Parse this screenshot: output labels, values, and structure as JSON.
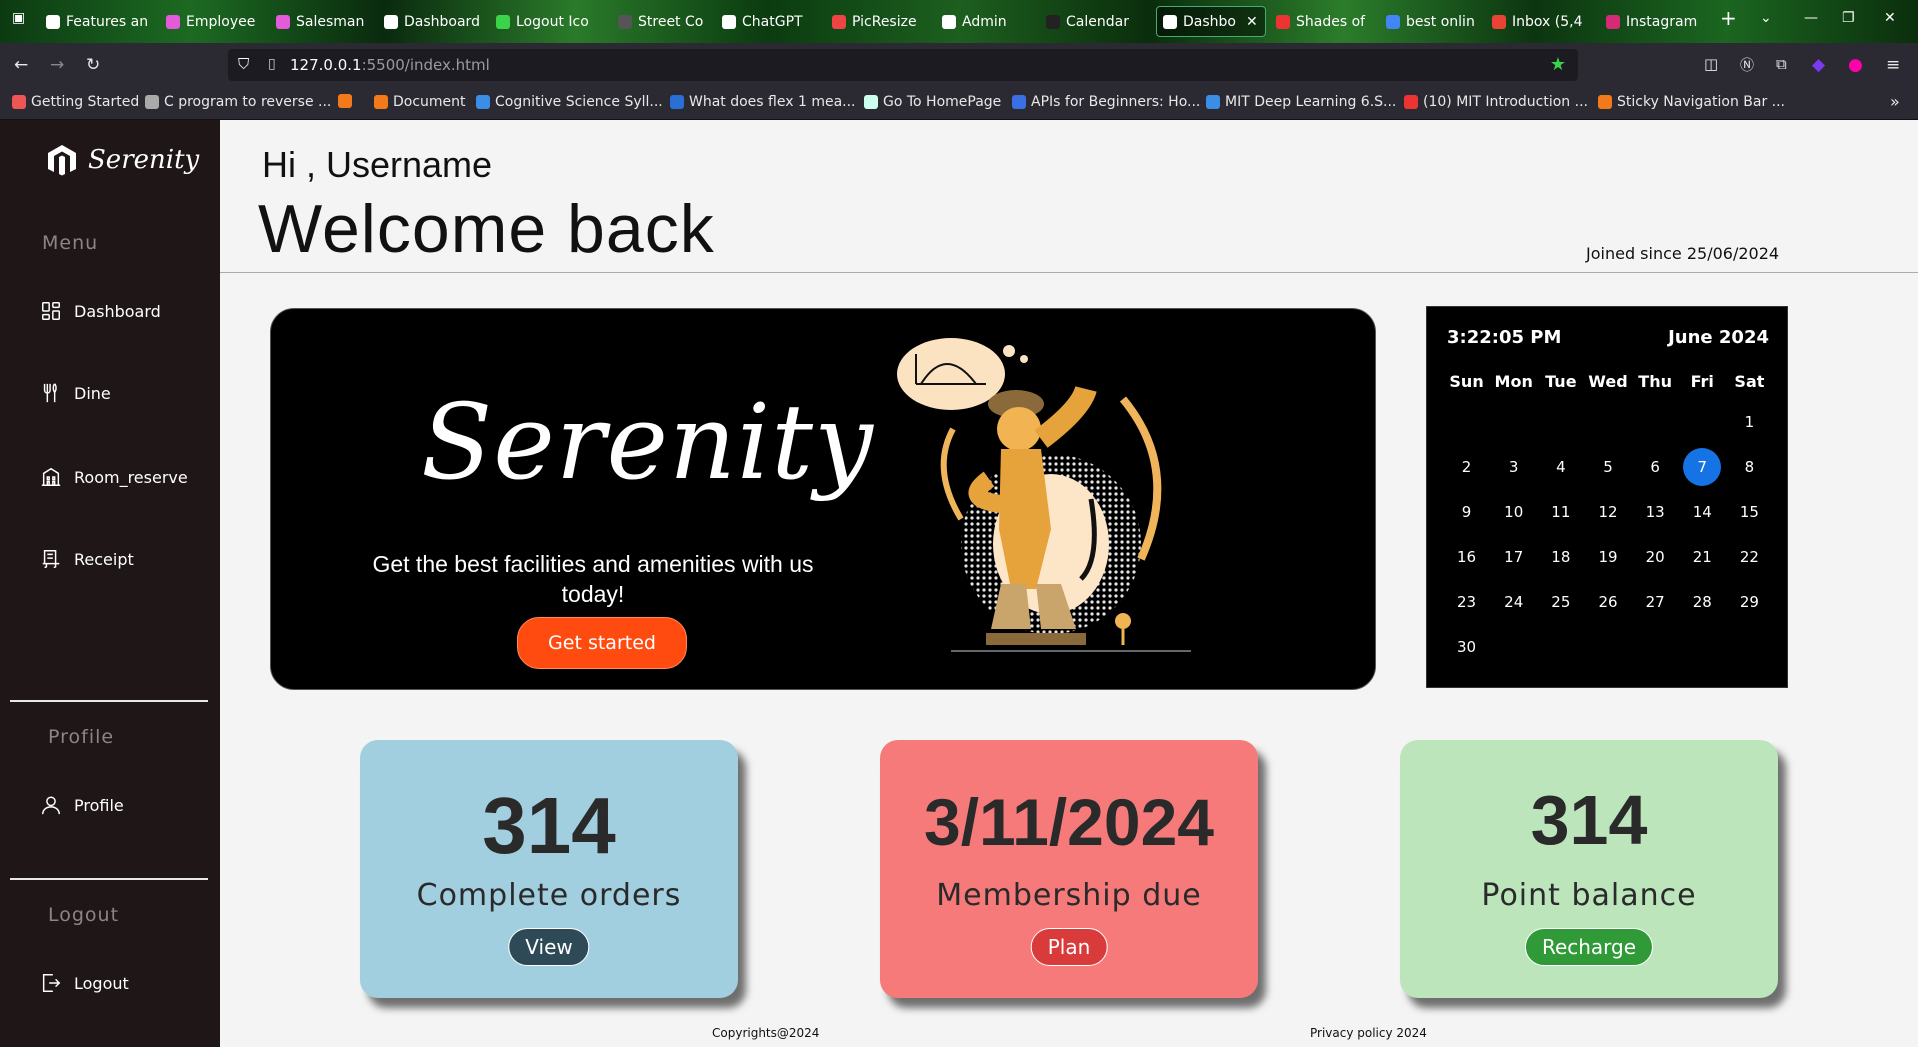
{
  "browser": {
    "tabs": [
      {
        "label": "Features and",
        "color": "#ffffff"
      },
      {
        "label": "Employee",
        "color": "#e45ad8"
      },
      {
        "label": "Salesman",
        "color": "#e45ad8"
      },
      {
        "label": "Dashboard",
        "color": "#ffffff"
      },
      {
        "label": "Logout Ico",
        "color": "#3ad34a"
      },
      {
        "label": "Street Co",
        "color": "#555555"
      },
      {
        "label": "ChatGPT",
        "color": "#ffffff"
      },
      {
        "label": "PicResize",
        "color": "#e44"
      },
      {
        "label": "Admin",
        "color": "#ffffff"
      },
      {
        "label": "Calendar",
        "color": "#222222"
      },
      {
        "label": "Dashbo",
        "color": "#ffffff"
      },
      {
        "label": "Shades of",
        "color": "#e33"
      },
      {
        "label": "best onlin",
        "color": "#4285f4"
      },
      {
        "label": "Inbox (5,4",
        "color": "#ea4335"
      },
      {
        "label": "Instagram",
        "color": "#d62976"
      }
    ],
    "url_host": "127.0.0.1",
    "url_path": ":5500/index.html",
    "bookmarks": [
      "Getting Started",
      "C program to reverse ...",
      "",
      "Document",
      "Cognitive Science Syll...",
      "What does flex 1 mea...",
      "Go To HomePage",
      "APIs for Beginners: Ho...",
      "MIT Deep Learning 6.S...",
      "(10) MIT Introduction ...",
      "Sticky Navigation Bar ..."
    ]
  },
  "sidebar": {
    "logo": "Serenity",
    "menu_label": "Menu",
    "items": [
      {
        "label": "Dashboard",
        "icon": "grid-icon"
      },
      {
        "label": "Dine",
        "icon": "utensils-icon"
      },
      {
        "label": "Room_reserve",
        "icon": "building-icon"
      },
      {
        "label": "Receipt",
        "icon": "receipt-icon"
      }
    ],
    "profile_label": "Profile",
    "profile_item": "Profile",
    "logout_label": "Logout",
    "logout_item": "Logout"
  },
  "header": {
    "greeting": "Hi , Username",
    "welcome": "Welcome back",
    "joined": "Joined since 25/06/2024"
  },
  "hero": {
    "title": "Serenity",
    "subtitle": "Get the best facilities and amenities with us today!",
    "button": "Get started",
    "button_color": "#ff4b0f"
  },
  "calendar": {
    "time": "3:22:05 PM",
    "month": "June 2024",
    "weekdays": [
      "Sun",
      "Mon",
      "Tue",
      "Wed",
      "Thu",
      "Fri",
      "Sat"
    ],
    "first_weekday": 6,
    "days": 30,
    "today": 7,
    "today_color": "#1673e6"
  },
  "cards": [
    {
      "value": "314",
      "label": "Complete orders",
      "button": "View",
      "bg": "#a2cfe0",
      "btn_bg": "#2f4a57"
    },
    {
      "value": "3/11/2024",
      "label": "Membership due",
      "button": "Plan",
      "bg": "#f67a7a",
      "btn_bg": "#d93b3b"
    },
    {
      "value": "314",
      "label": "Point balance",
      "button": "Recharge",
      "bg": "#bde5bb",
      "btn_bg": "#2f9a37"
    }
  ],
  "footer": {
    "copyright": "Copyrights@2024",
    "privacy": "Privacy policy 2024"
  }
}
